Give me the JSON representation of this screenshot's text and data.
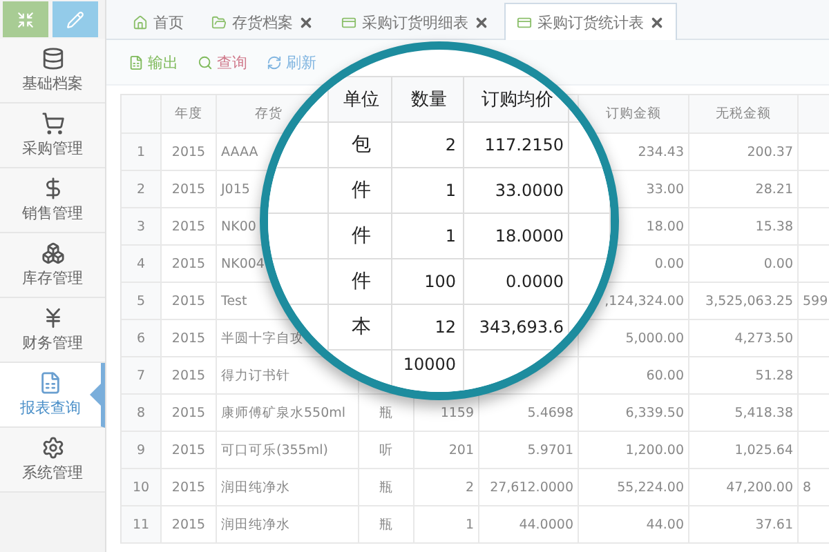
{
  "sidebar": {
    "items": [
      {
        "label": "基础档案",
        "selected": false
      },
      {
        "label": "采购管理",
        "selected": false
      },
      {
        "label": "销售管理",
        "selected": false
      },
      {
        "label": "库存管理",
        "selected": false
      },
      {
        "label": "财务管理",
        "selected": false
      },
      {
        "label": "报表查询",
        "selected": true
      },
      {
        "label": "系统管理",
        "selected": false
      }
    ]
  },
  "tabs": [
    {
      "label": "首页",
      "closable": false,
      "selected": false
    },
    {
      "label": "存货档案",
      "closable": true,
      "selected": false
    },
    {
      "label": "采购订货明细表",
      "closable": true,
      "selected": false
    },
    {
      "label": "采购订货统计表",
      "closable": true,
      "selected": true
    }
  ],
  "toolbar": [
    {
      "label": "输出"
    },
    {
      "label": "查询"
    },
    {
      "label": "刷新"
    }
  ],
  "table": {
    "columns": [
      null,
      "年度",
      "存货",
      null,
      null,
      null,
      "订购金额",
      "无税金额",
      null
    ],
    "rows": [
      {
        "cells": [
          "1",
          "2015",
          "AAAA",
          null,
          null,
          null,
          "234.43",
          "200.37",
          null
        ]
      },
      {
        "cells": [
          "2",
          "2015",
          "J015",
          null,
          null,
          null,
          "33.00",
          "28.21",
          null
        ]
      },
      {
        "cells": [
          "3",
          "2015",
          "NK00",
          null,
          null,
          null,
          "18.00",
          "15.38",
          null
        ]
      },
      {
        "cells": [
          "4",
          "2015",
          "NK004",
          null,
          null,
          null,
          "0.00",
          "0.00",
          null
        ]
      },
      {
        "cells": [
          "5",
          "2015",
          "Test",
          null,
          null,
          null,
          ",124,324.00",
          "3,525,063.25",
          "599"
        ]
      },
      {
        "cells": [
          "6",
          "2015",
          "半圆十字自攻",
          null,
          null,
          null,
          "5,000.00",
          "4,273.50",
          null
        ]
      },
      {
        "cells": [
          "7",
          "2015",
          "得力订书针",
          null,
          null,
          null,
          "60.00",
          "51.28",
          null
        ]
      },
      {
        "cells": [
          "8",
          "2015",
          "康师傅矿泉水550ml",
          "瓶",
          "1159",
          "5.4698",
          "6,339.50",
          "5,418.38",
          null
        ]
      },
      {
        "cells": [
          "9",
          "2015",
          "可口可乐(355ml)",
          "听",
          "201",
          "5.9701",
          "1,200.00",
          "1,025.64",
          null
        ]
      },
      {
        "cells": [
          "10",
          "2015",
          "润田纯净水",
          "瓶",
          "2",
          "27,612.0000",
          "55,224.00",
          "47,200.00",
          "8"
        ]
      },
      {
        "cells": [
          "11",
          "2015",
          "润田纯净水",
          "瓶",
          "1",
          "44.0000",
          "44.00",
          "37.61",
          null
        ]
      }
    ]
  },
  "magnifier": {
    "columns": [
      "单位",
      "数量",
      "订购均价"
    ],
    "rows": [
      [
        "包",
        "2",
        "117.2150"
      ],
      [
        "件",
        "1",
        "33.0000"
      ],
      [
        "件",
        "1",
        "18.0000"
      ],
      [
        "件",
        "100",
        "0.0000"
      ],
      [
        "本",
        "12",
        "343,693.6"
      ],
      [
        null,
        "10000",
        null
      ]
    ]
  }
}
